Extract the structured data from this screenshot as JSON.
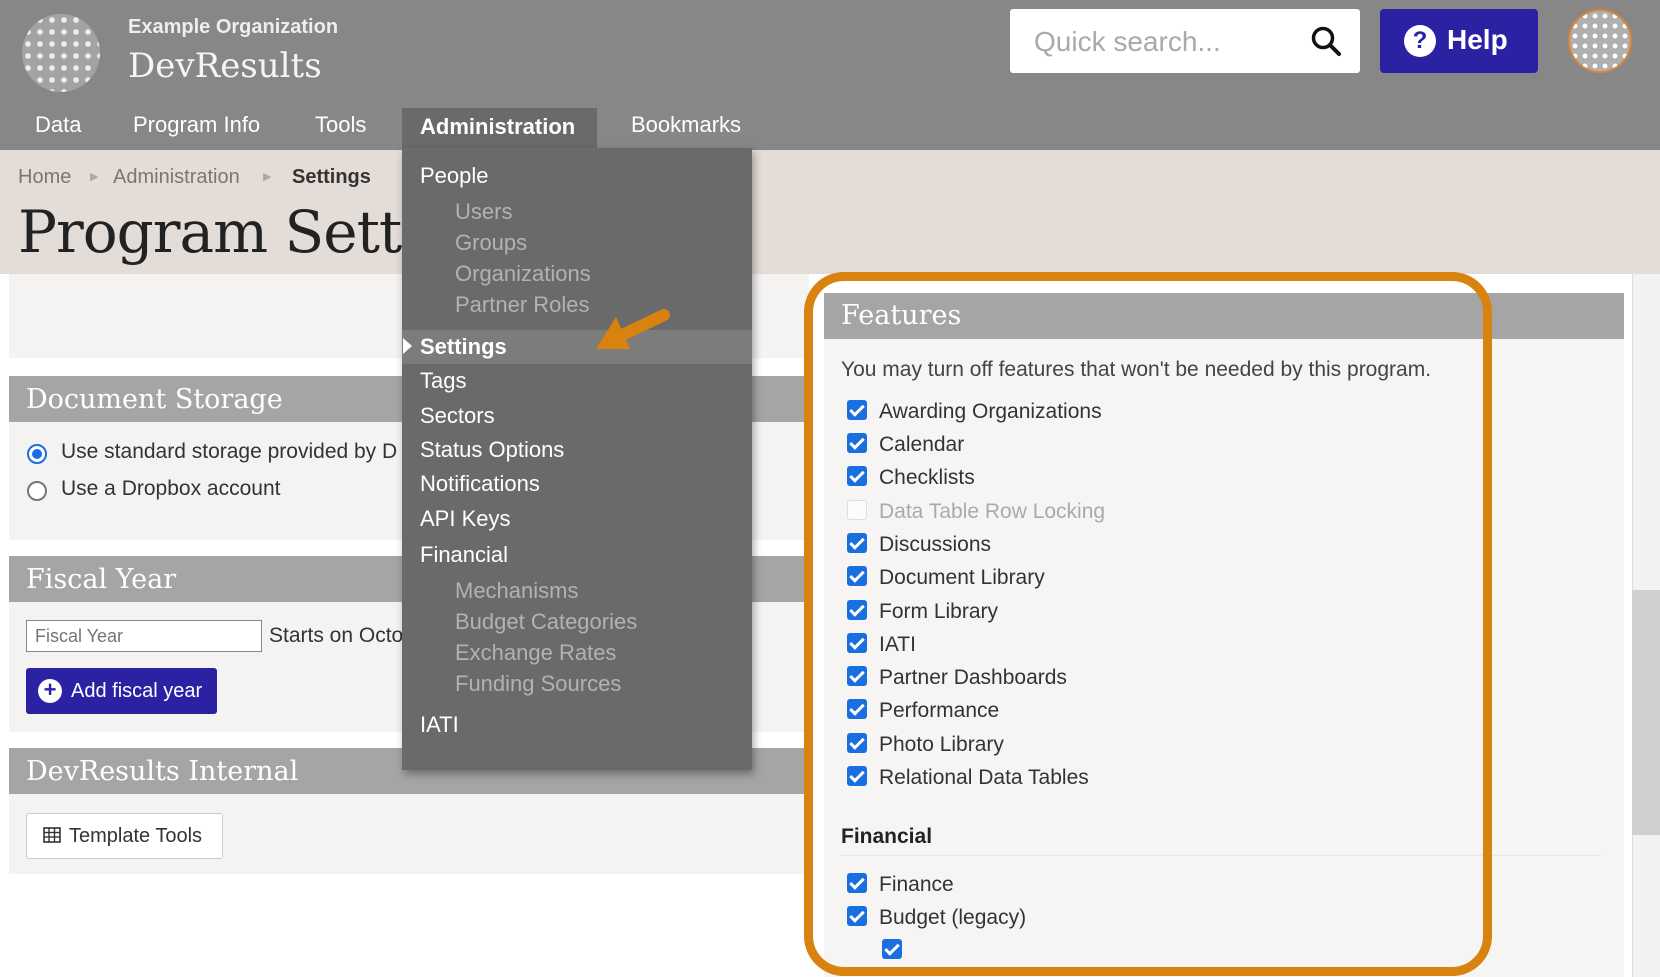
{
  "header": {
    "org_name": "Example Organization",
    "app_name": "DevResults",
    "search_placeholder": "Quick search...",
    "help_label": "Help",
    "help_icon_glyph": "?"
  },
  "nav": {
    "items": [
      "Data",
      "Program Info",
      "Tools",
      "Administration",
      "Bookmarks"
    ],
    "active": "Administration"
  },
  "breadcrumb": [
    "Home",
    "Administration",
    "Settings"
  ],
  "page_title": "Program Settings",
  "admin_menu": {
    "people": {
      "label": "People",
      "items": [
        "Users",
        "Groups",
        "Organizations",
        "Partner Roles"
      ]
    },
    "settings": "Settings",
    "tags": "Tags",
    "sectors": "Sectors",
    "status_options": "Status Options",
    "notifications": "Notifications",
    "api_keys": "API Keys",
    "financial": {
      "label": "Financial",
      "items": [
        "Mechanisms",
        "Budget Categories",
        "Exchange Rates",
        "Funding Sources"
      ]
    },
    "iati": "IATI"
  },
  "document_storage": {
    "title": "Document Storage",
    "options": [
      "Use standard storage provided by D",
      "Use a Dropbox account"
    ],
    "selected_index": 0
  },
  "fiscal_year": {
    "title": "Fiscal Year",
    "input_placeholder": "Fiscal Year",
    "starts_text": "Starts on Octo",
    "add_button": "Add fiscal year",
    "add_icon_glyph": "+"
  },
  "internal": {
    "title": "DevResults Internal",
    "template_button": "Template Tools"
  },
  "features": {
    "title": "Features",
    "description": "You may turn off features that won't be needed by this program.",
    "items": [
      {
        "label": "Awarding Organizations",
        "checked": true,
        "disabled": false
      },
      {
        "label": "Calendar",
        "checked": true,
        "disabled": false
      },
      {
        "label": "Checklists",
        "checked": true,
        "disabled": false
      },
      {
        "label": "Data Table Row Locking",
        "checked": false,
        "disabled": true
      },
      {
        "label": "Discussions",
        "checked": true,
        "disabled": false
      },
      {
        "label": "Document Library",
        "checked": true,
        "disabled": false
      },
      {
        "label": "Form Library",
        "checked": true,
        "disabled": false
      },
      {
        "label": "IATI",
        "checked": true,
        "disabled": false
      },
      {
        "label": "Partner Dashboards",
        "checked": true,
        "disabled": false
      },
      {
        "label": "Performance",
        "checked": true,
        "disabled": false
      },
      {
        "label": "Photo Library",
        "checked": true,
        "disabled": false
      },
      {
        "label": "Relational Data Tables",
        "checked": true,
        "disabled": false
      }
    ],
    "financial_heading": "Financial",
    "financial_items": [
      {
        "label": "Finance",
        "checked": true
      },
      {
        "label": "Budget (legacy)",
        "checked": true
      }
    ],
    "nested_checked": true
  },
  "colors": {
    "topbar": "#878787",
    "accent_blue": "#2b21a3",
    "highlight_orange": "#d8820f",
    "checkbox_blue": "#1a6fe0"
  }
}
